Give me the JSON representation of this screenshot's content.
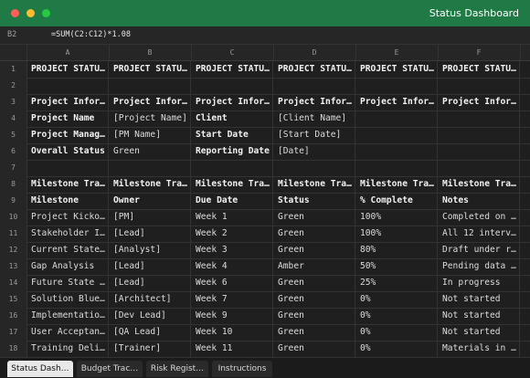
{
  "window": {
    "title": "Status Dashboard"
  },
  "formula_bar": {
    "cell_ref": "B2",
    "formula": "=SUM(C2:C12)*1.08"
  },
  "columns": [
    "A",
    "B",
    "C",
    "D",
    "E",
    "F"
  ],
  "rows": [
    {
      "num": "1",
      "cells": [
        "PROJECT STATU…",
        "PROJECT STATU…",
        "PROJECT STATU…",
        "PROJECT STATU…",
        "PROJECT STATU…",
        "PROJECT STATU…"
      ],
      "bold": [
        true,
        true,
        true,
        true,
        true,
        true
      ]
    },
    {
      "num": "2",
      "cells": [
        "",
        "",
        "",
        "",
        "",
        ""
      ],
      "bold": [
        false,
        false,
        false,
        false,
        false,
        false
      ]
    },
    {
      "num": "3",
      "cells": [
        "Project Infor…",
        "Project Infor…",
        "Project Infor…",
        "Project Infor…",
        "Project Infor…",
        "Project Infor…"
      ],
      "bold": [
        true,
        true,
        true,
        true,
        true,
        true
      ]
    },
    {
      "num": "4",
      "cells": [
        "Project Name",
        "[Project Name]",
        "Client",
        "[Client Name]",
        "",
        ""
      ],
      "bold": [
        true,
        false,
        true,
        false,
        false,
        false
      ]
    },
    {
      "num": "5",
      "cells": [
        "Project Manag…",
        "[PM Name]",
        "Start Date",
        "[Start Date]",
        "",
        ""
      ],
      "bold": [
        true,
        false,
        true,
        false,
        false,
        false
      ]
    },
    {
      "num": "6",
      "cells": [
        "Overall Status",
        "Green",
        "Reporting Date",
        "[Date]",
        "",
        ""
      ],
      "bold": [
        true,
        false,
        true,
        false,
        false,
        false
      ]
    },
    {
      "num": "7",
      "cells": [
        "",
        "",
        "",
        "",
        "",
        ""
      ],
      "bold": [
        false,
        false,
        false,
        false,
        false,
        false
      ]
    },
    {
      "num": "8",
      "cells": [
        "Milestone Tra…",
        "Milestone Tra…",
        "Milestone Tra…",
        "Milestone Tra…",
        "Milestone Tra…",
        "Milestone Tra…"
      ],
      "bold": [
        true,
        true,
        true,
        true,
        true,
        true
      ]
    },
    {
      "num": "9",
      "cells": [
        "Milestone",
        "Owner",
        "Due Date",
        "Status",
        "% Complete",
        "Notes"
      ],
      "bold": [
        true,
        true,
        true,
        true,
        true,
        true
      ]
    },
    {
      "num": "10",
      "cells": [
        "Project Kicko…",
        "[PM]",
        "Week 1",
        "Green",
        "100%",
        "Completed on …"
      ],
      "bold": [
        false,
        false,
        false,
        false,
        false,
        false
      ]
    },
    {
      "num": "11",
      "cells": [
        "Stakeholder I…",
        "[Lead]",
        "Week 2",
        "Green",
        "100%",
        "All 12 interv…"
      ],
      "bold": [
        false,
        false,
        false,
        false,
        false,
        false
      ]
    },
    {
      "num": "12",
      "cells": [
        "Current State…",
        "[Analyst]",
        "Week 3",
        "Green",
        "80%",
        "Draft under r…"
      ],
      "bold": [
        false,
        false,
        false,
        false,
        false,
        false
      ]
    },
    {
      "num": "13",
      "cells": [
        "Gap Analysis",
        "[Lead]",
        "Week 4",
        "Amber",
        "50%",
        "Pending data …"
      ],
      "bold": [
        false,
        false,
        false,
        false,
        false,
        false
      ]
    },
    {
      "num": "14",
      "cells": [
        "Future State …",
        "[Lead]",
        "Week 6",
        "Green",
        "25%",
        "In progress"
      ],
      "bold": [
        false,
        false,
        false,
        false,
        false,
        false
      ]
    },
    {
      "num": "15",
      "cells": [
        "Solution Blue…",
        "[Architect]",
        "Week 7",
        "Green",
        "0%",
        "Not started"
      ],
      "bold": [
        false,
        false,
        false,
        false,
        false,
        false
      ]
    },
    {
      "num": "16",
      "cells": [
        "Implementatio…",
        "[Dev Lead]",
        "Week 9",
        "Green",
        "0%",
        "Not started"
      ],
      "bold": [
        false,
        false,
        false,
        false,
        false,
        false
      ]
    },
    {
      "num": "17",
      "cells": [
        "User Acceptan…",
        "[QA Lead]",
        "Week 10",
        "Green",
        "0%",
        "Not started"
      ],
      "bold": [
        false,
        false,
        false,
        false,
        false,
        false
      ]
    },
    {
      "num": "18",
      "cells": [
        "Training Deli…",
        "[Trainer]",
        "Week 11",
        "Green",
        "0%",
        "Materials in …"
      ],
      "bold": [
        false,
        false,
        false,
        false,
        false,
        false
      ]
    }
  ],
  "sheet_tabs": [
    {
      "label": "Status Dash…",
      "active": true
    },
    {
      "label": "Budget Trac…",
      "active": false
    },
    {
      "label": "Risk Regist…",
      "active": false
    },
    {
      "label": "Instructions",
      "active": false
    }
  ],
  "colors": {
    "titlebar": "#1f7a45",
    "background": "#1f1f1f"
  }
}
